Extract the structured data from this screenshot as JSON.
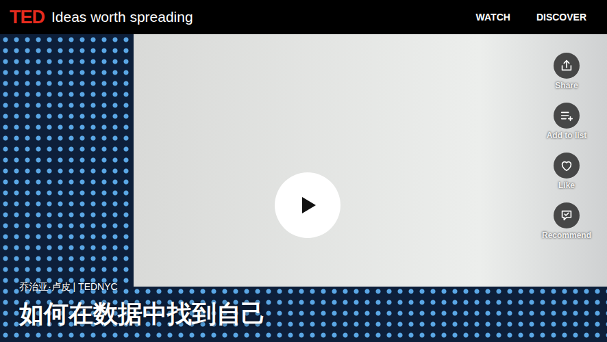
{
  "header": {
    "logo": "TED",
    "tagline": "Ideas worth spreading",
    "nav": [
      {
        "label": "WATCH"
      },
      {
        "label": "DISCOVER"
      }
    ]
  },
  "actions": [
    {
      "label": "Share"
    },
    {
      "label": "Add to list"
    },
    {
      "label": "Like"
    },
    {
      "label": "Recommend"
    }
  ],
  "caption": {
    "speaker": "乔治亚·卢皮 | TEDNYC",
    "title": "如何在数据中找到自己"
  }
}
